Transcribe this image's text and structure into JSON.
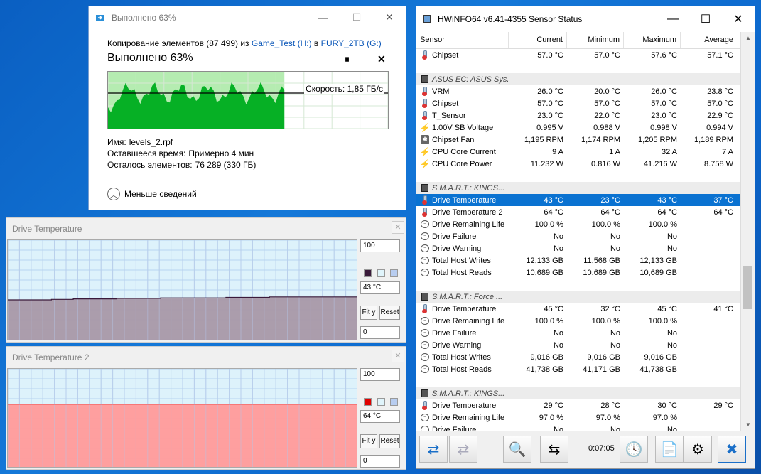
{
  "copy_dialog": {
    "title": "Выполнено 63%",
    "line_prefix": "Копирование элементов (87 499) из",
    "source": "Game_Test (H:)",
    "line_mid": "в",
    "dest": "FURY_2TB (G:)",
    "progress_heading": "Выполнено 63%",
    "progress_fraction": 0.63,
    "pause_glyph": "⏸",
    "cancel_glyph": "✕",
    "speed": "Скорость: 1,85 ГБ/с",
    "name_label": "Имя:",
    "name_value": "levels_2.rpf",
    "time_label": "Оставшееся время:",
    "time_value": "Примерно 4 мин",
    "items_label": "Осталось элементов:",
    "items_value": "76 289 (330 ГБ)",
    "less_details": "Меньше сведений",
    "accent_green": "#06b025"
  },
  "graph1": {
    "title": "Drive Temperature",
    "max": "100",
    "current": "43 °C",
    "min": "0",
    "fit_label": "Fit y",
    "reset_label": "Reset",
    "close_glyph": "✕",
    "fill_color": "#a898a8",
    "line_color": "#3a1a3a",
    "values": [
      40,
      40,
      40.5,
      41,
      41,
      41.5,
      41.5,
      42,
      42,
      42,
      42.5,
      42.5,
      43,
      43,
      43,
      43
    ]
  },
  "graph2": {
    "title": "Drive Temperature 2",
    "max": "100",
    "current": "64 °C",
    "min": "0",
    "fit_label": "Fit y",
    "reset_label": "Reset",
    "close_glyph": "✕",
    "fill_color": "#ff9a9a",
    "line_color": "#e00000",
    "values": [
      64,
      64,
      64,
      64,
      64,
      64,
      64,
      64,
      64,
      64,
      64,
      64,
      64,
      64,
      64,
      64
    ]
  },
  "hwinfo": {
    "title": "HWiNFO64 v6.41-4355 Sensor Status",
    "columns": [
      "Sensor",
      "Current",
      "Minimum",
      "Maximum",
      "Average"
    ],
    "timer": "0:07:05",
    "rows": [
      {
        "type": "s",
        "icon": "therm",
        "name": "Chipset",
        "v": [
          "57.0 °C",
          "57.0 °C",
          "57.6 °C",
          "57.1 °C"
        ]
      },
      {
        "type": "blank"
      },
      {
        "type": "g",
        "name": "ASUS EC: ASUS Sys..."
      },
      {
        "type": "s",
        "icon": "therm",
        "name": "VRM",
        "v": [
          "26.0 °C",
          "20.0 °C",
          "26.0 °C",
          "23.8 °C"
        ]
      },
      {
        "type": "s",
        "icon": "therm",
        "name": "Chipset",
        "v": [
          "57.0 °C",
          "57.0 °C",
          "57.0 °C",
          "57.0 °C"
        ]
      },
      {
        "type": "s",
        "icon": "therm",
        "name": "T_Sensor",
        "v": [
          "23.0 °C",
          "22.0 °C",
          "23.0 °C",
          "22.9 °C"
        ]
      },
      {
        "type": "s",
        "icon": "bolt",
        "name": "1.00V SB Voltage",
        "v": [
          "0.995 V",
          "0.988 V",
          "0.998 V",
          "0.994 V"
        ]
      },
      {
        "type": "s",
        "icon": "fan",
        "name": "Chipset Fan",
        "v": [
          "1,195 RPM",
          "1,174 RPM",
          "1,205 RPM",
          "1,189 RPM"
        ]
      },
      {
        "type": "s",
        "icon": "bolt",
        "name": "CPU Core Current",
        "v": [
          "9 A",
          "1 A",
          "32 A",
          "7 A"
        ]
      },
      {
        "type": "s",
        "icon": "bolt",
        "name": "CPU Core Power",
        "v": [
          "11.232 W",
          "0.816 W",
          "41.216 W",
          "8.758 W"
        ]
      },
      {
        "type": "blank"
      },
      {
        "type": "g",
        "name": "S.M.A.R.T.: KINGS..."
      },
      {
        "type": "s",
        "icon": "therm",
        "name": "Drive Temperature",
        "v": [
          "43 °C",
          "23 °C",
          "43 °C",
          "37 °C"
        ],
        "sel": true
      },
      {
        "type": "s",
        "icon": "therm",
        "name": "Drive Temperature 2",
        "v": [
          "64 °C",
          "64 °C",
          "64 °C",
          "64 °C"
        ]
      },
      {
        "type": "s",
        "icon": "ring",
        "name": "Drive Remaining Life",
        "v": [
          "100.0 %",
          "100.0 %",
          "100.0 %",
          ""
        ]
      },
      {
        "type": "s",
        "icon": "ring",
        "name": "Drive Failure",
        "v": [
          "No",
          "No",
          "No",
          ""
        ]
      },
      {
        "type": "s",
        "icon": "ring",
        "name": "Drive Warning",
        "v": [
          "No",
          "No",
          "No",
          ""
        ]
      },
      {
        "type": "s",
        "icon": "ring",
        "name": "Total Host Writes",
        "v": [
          "12,133 GB",
          "11,568 GB",
          "12,133 GB",
          ""
        ]
      },
      {
        "type": "s",
        "icon": "ring",
        "name": "Total Host Reads",
        "v": [
          "10,689 GB",
          "10,689 GB",
          "10,689 GB",
          ""
        ]
      },
      {
        "type": "blank"
      },
      {
        "type": "g",
        "name": "S.M.A.R.T.: Force ..."
      },
      {
        "type": "s",
        "icon": "therm",
        "name": "Drive Temperature",
        "v": [
          "45 °C",
          "32 °C",
          "45 °C",
          "41 °C"
        ]
      },
      {
        "type": "s",
        "icon": "ring",
        "name": "Drive Remaining Life",
        "v": [
          "100.0 %",
          "100.0 %",
          "100.0 %",
          ""
        ]
      },
      {
        "type": "s",
        "icon": "ring",
        "name": "Drive Failure",
        "v": [
          "No",
          "No",
          "No",
          ""
        ]
      },
      {
        "type": "s",
        "icon": "ring",
        "name": "Drive Warning",
        "v": [
          "No",
          "No",
          "No",
          ""
        ]
      },
      {
        "type": "s",
        "icon": "ring",
        "name": "Total Host Writes",
        "v": [
          "9,016 GB",
          "9,016 GB",
          "9,016 GB",
          ""
        ]
      },
      {
        "type": "s",
        "icon": "ring",
        "name": "Total Host Reads",
        "v": [
          "41,738 GB",
          "41,171 GB",
          "41,738 GB",
          ""
        ]
      },
      {
        "type": "blank"
      },
      {
        "type": "g",
        "name": "S.M.A.R.T.: KINGS..."
      },
      {
        "type": "s",
        "icon": "therm",
        "name": "Drive Temperature",
        "v": [
          "29 °C",
          "28 °C",
          "30 °C",
          "29 °C"
        ]
      },
      {
        "type": "s",
        "icon": "ring",
        "name": "Drive Remaining Life",
        "v": [
          "97.0 %",
          "97.0 %",
          "97.0 %",
          ""
        ]
      },
      {
        "type": "s",
        "icon": "ring",
        "name": "Drive Failure",
        "v": [
          "No",
          "No",
          "No",
          ""
        ]
      }
    ],
    "toolbar": [
      {
        "name": "nav-arrows-button",
        "glyph": "⇄"
      },
      {
        "name": "nav-arrows-disabled-button",
        "glyph": "⇄"
      },
      {
        "name": "monitor-search-button",
        "glyph": "🔍"
      },
      {
        "name": "network-button",
        "glyph": "⇆"
      },
      {
        "name": "clock-icon-button",
        "glyph": "🕓"
      },
      {
        "name": "add-report-button",
        "glyph": "📄"
      },
      {
        "name": "settings-button",
        "glyph": "⚙"
      },
      {
        "name": "close-button",
        "glyph": "✖"
      }
    ]
  }
}
